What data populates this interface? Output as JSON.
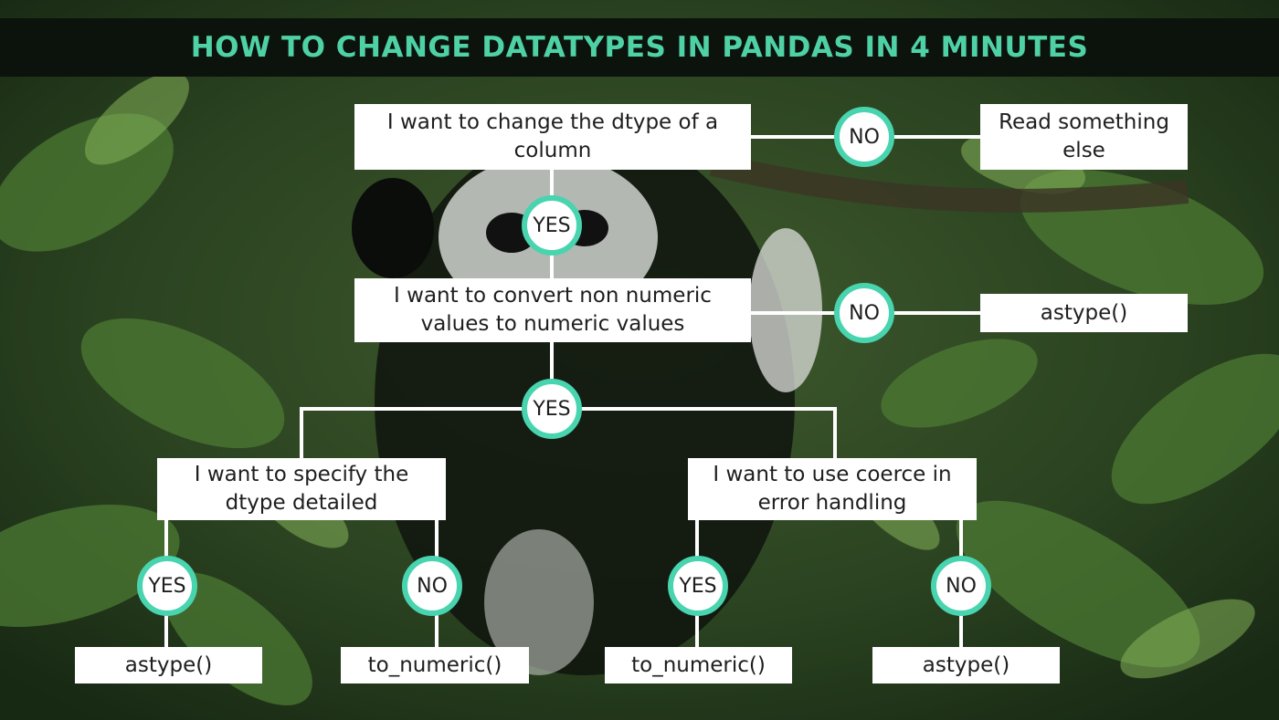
{
  "title": "HOW TO CHANGE DATATYPES IN PANDAS IN 4 MINUTES",
  "colors": {
    "title_text": "#4fd1a6",
    "title_bar": "#0c120c",
    "badge_ring": "#48d4ae",
    "connector": "#ffffff",
    "box_bg": "#ffffff"
  },
  "background": {
    "subject": "panda-in-tree-photo"
  },
  "nodes": {
    "q1": "I want to change the dtype of a column",
    "read_else": "Read something else",
    "q2": "I want to convert non numeric values to numeric values",
    "astype_top": "astype()",
    "q3": "I want to specify the dtype detailed",
    "q4": "I want to use coerce in error handling",
    "leaf1": "astype()",
    "leaf2": "to_numeric()",
    "leaf3": "to_numeric()",
    "leaf4": "astype()"
  },
  "answers": {
    "yes": "YES",
    "no": "NO"
  }
}
